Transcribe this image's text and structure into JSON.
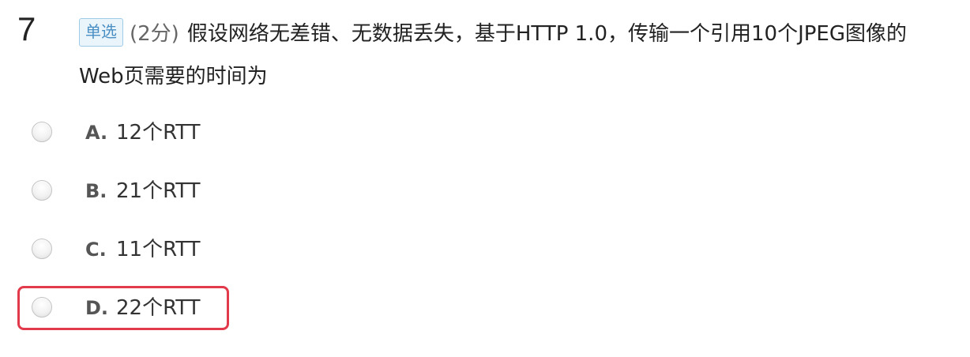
{
  "question": {
    "number": "7",
    "type_badge": "单选",
    "score": "(2分)",
    "text": "假设网络无差错、无数据丢失，基于HTTP 1.0，传输一个引用10个JPEG图像的Web页需要的时间为"
  },
  "options": [
    {
      "letter": "A.",
      "text": "12个RTT",
      "highlighted": false
    },
    {
      "letter": "B.",
      "text": "21个RTT",
      "highlighted": false
    },
    {
      "letter": "C.",
      "text": "11个RTT",
      "highlighted": false
    },
    {
      "letter": "D.",
      "text": "22个RTT",
      "highlighted": true
    }
  ],
  "colors": {
    "highlight_border": "#e23a4a",
    "badge_text": "#4a8fc4",
    "badge_background": "#eaf4fb",
    "badge_border": "#9fcbe8"
  }
}
